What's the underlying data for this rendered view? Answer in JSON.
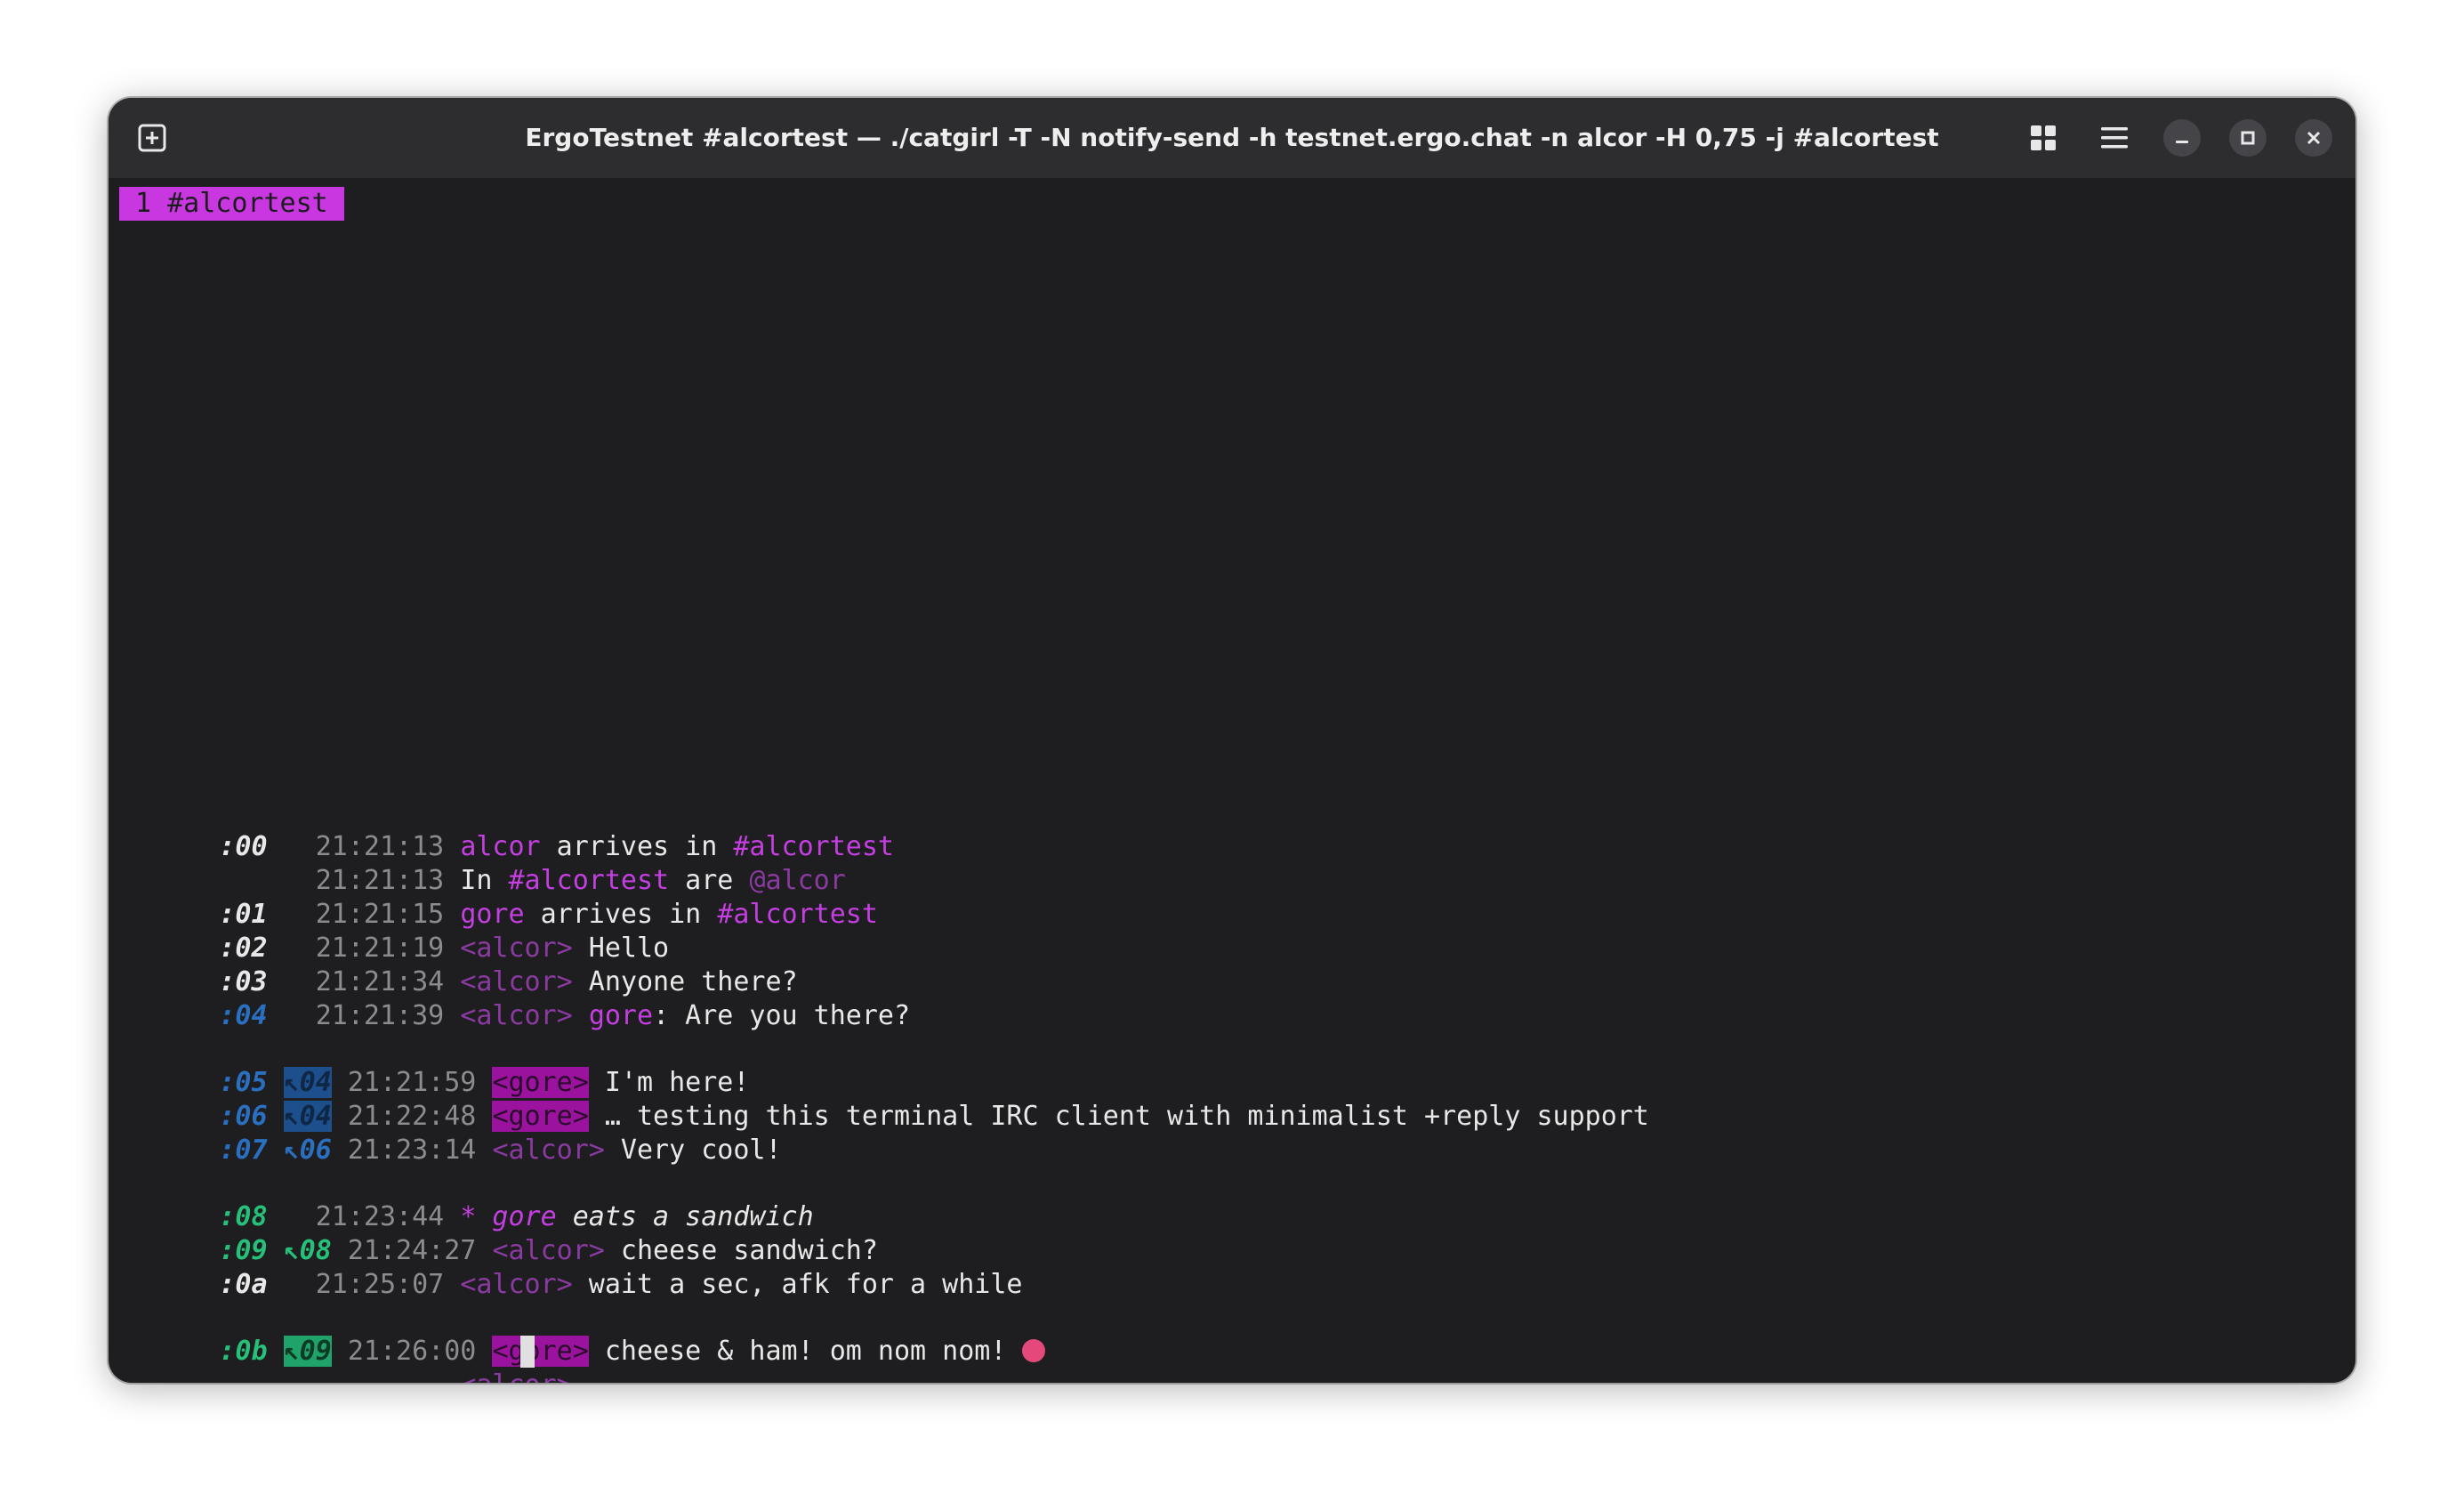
{
  "window": {
    "title": "ErgoTestnet #alcortest — ./catgirl -T -N notify-send -h testnet.ergo.chat -n alcor -H 0,75 -j #alcortest",
    "icons": {
      "new_tab": "new-tab-icon",
      "grid": "grid-icon",
      "menu": "hamburger-menu-icon",
      "minimize": "minimize-icon",
      "maximize": "maximize-icon",
      "close": "close-icon"
    }
  },
  "tabline": {
    "label": "1 #alcortest"
  },
  "colors": {
    "magenta": "#c43fe0",
    "blue_id": "#2a6fc0",
    "green_id": "#27c07a",
    "timestamp": "#8c8c90",
    "highlight_bg": "#9a129e",
    "tab_bg": "#c837e0"
  },
  "lines": [
    {
      "id": ":00",
      "ref": "",
      "time": "21:21:13",
      "nick": "alcor",
      "text_pre": " arrives in ",
      "channel": "#alcortest"
    },
    {
      "id": "",
      "ref": "",
      "time": "21:21:13",
      "pre": "In ",
      "channel": "#alcortest",
      "mid": " are ",
      "nick": "@alcor"
    },
    {
      "id": ":01",
      "ref": "",
      "time": "21:21:15",
      "nick": "gore",
      "text_pre": " arrives in ",
      "channel": "#alcortest"
    },
    {
      "id": ":02",
      "ref": "",
      "time": "21:21:19",
      "nick": "<alcor>",
      "text": " Hello"
    },
    {
      "id": ":03",
      "ref": "",
      "time": "21:21:34",
      "nick": "<alcor>",
      "text": " Anyone there?"
    },
    {
      "id": ":04",
      "ref": "",
      "time": "21:21:39",
      "nick": "<alcor>",
      "mention": "gore",
      "text": ": Are you there?"
    },
    {
      "id": ":05",
      "ref": "↖04",
      "time": "21:21:59",
      "nick": "<gore>",
      "text": " I'm here!"
    },
    {
      "id": ":06",
      "ref": "↖04",
      "time": "21:22:48",
      "nick": "<gore>",
      "text": " … testing this terminal IRC client with minimalist +reply support"
    },
    {
      "id": ":07",
      "ref": "↖06",
      "time": "21:23:14",
      "nick": "<alcor>",
      "text": " Very cool!"
    },
    {
      "id": ":08",
      "ref": "",
      "time": "21:23:44",
      "action": "* gore",
      "text": " eats a sandwich"
    },
    {
      "id": ":09",
      "ref": "↖08",
      "time": "21:24:27",
      "nick": "<alcor>",
      "text": " cheese sandwich?"
    },
    {
      "id": ":0a",
      "ref": "",
      "time": "21:25:07",
      "nick": "<alcor>",
      "text": " wait a sec, afk for a while"
    },
    {
      "id": ":0b",
      "ref": "↖09",
      "time": "21:26:00",
      "nick": "<gore>",
      "text": " cheese & ham! om nom nom! "
    }
  ],
  "input": {
    "prompt": "<alcor>",
    "emoji_icon": "tongue-face-icon"
  }
}
